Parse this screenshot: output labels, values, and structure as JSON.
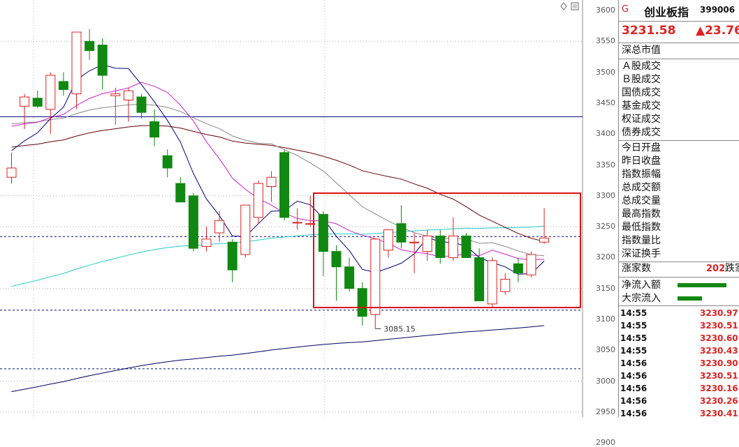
{
  "chart": {
    "y_ticks": [
      "3600",
      "3550",
      "3500",
      "3450",
      "3400",
      "3350",
      "3300",
      "3250",
      "3200",
      "3150",
      "3100",
      "3050",
      "3000",
      "2950",
      "2900"
    ],
    "low_label": "3085.15",
    "colors": {
      "up": "#dd2222",
      "down": "#118811",
      "ma5": "#000080",
      "ma10": "#cc22cc",
      "ma20": "#888888",
      "ma30": "#660000",
      "ma60": "#22cccc",
      "ma120": "#000060",
      "highlight_box": "#dd1111",
      "h_solid": "#000080",
      "h_dashed": "#000080"
    }
  },
  "chart_data": {
    "type": "candlestick",
    "ylim": [
      2900,
      3600
    ],
    "candles": [
      {
        "o": 3330,
        "h": 3370,
        "l": 3320,
        "c": 3345
      },
      {
        "o": 3445,
        "h": 3465,
        "l": 3408,
        "c": 3460
      },
      {
        "o": 3458,
        "h": 3470,
        "l": 3442,
        "c": 3445
      },
      {
        "o": 3440,
        "h": 3500,
        "l": 3400,
        "c": 3495
      },
      {
        "o": 3485,
        "h": 3500,
        "l": 3462,
        "c": 3472
      },
      {
        "o": 3465,
        "h": 3565,
        "l": 3440,
        "c": 3565
      },
      {
        "o": 3550,
        "h": 3570,
        "l": 3520,
        "c": 3535
      },
      {
        "o": 3544,
        "h": 3555,
        "l": 3472,
        "c": 3495
      },
      {
        "o": 3462,
        "h": 3475,
        "l": 3415,
        "c": 3465
      },
      {
        "o": 3455,
        "h": 3475,
        "l": 3420,
        "c": 3470
      },
      {
        "o": 3460,
        "h": 3465,
        "l": 3425,
        "c": 3435
      },
      {
        "o": 3420,
        "h": 3440,
        "l": 3380,
        "c": 3395
      },
      {
        "o": 3365,
        "h": 3375,
        "l": 3330,
        "c": 3345
      },
      {
        "o": 3320,
        "h": 3330,
        "l": 3290,
        "c": 3290
      },
      {
        "o": 3300,
        "h": 3305,
        "l": 3210,
        "c": 3215
      },
      {
        "o": 3218,
        "h": 3250,
        "l": 3210,
        "c": 3230
      },
      {
        "o": 3240,
        "h": 3275,
        "l": 3225,
        "c": 3260
      },
      {
        "o": 3225,
        "h": 3230,
        "l": 3160,
        "c": 3180
      },
      {
        "o": 3205,
        "h": 3285,
        "l": 3200,
        "c": 3285
      },
      {
        "o": 3265,
        "h": 3325,
        "l": 3255,
        "c": 3320
      },
      {
        "o": 3315,
        "h": 3340,
        "l": 3290,
        "c": 3330
      },
      {
        "o": 3370,
        "h": 3375,
        "l": 3260,
        "c": 3265
      },
      {
        "o": 3257,
        "h": 3280,
        "l": 3245,
        "c": 3257
      },
      {
        "o": 3255,
        "h": 3300,
        "l": 3250,
        "c": 3255
      },
      {
        "o": 3270,
        "h": 3275,
        "l": 3170,
        "c": 3210
      },
      {
        "o": 3210,
        "h": 3220,
        "l": 3130,
        "c": 3185
      },
      {
        "o": 3185,
        "h": 3200,
        "l": 3145,
        "c": 3150
      },
      {
        "o": 3150,
        "h": 3160,
        "l": 3090,
        "c": 3105
      },
      {
        "o": 3108,
        "h": 3230,
        "l": 3085,
        "c": 3230
      },
      {
        "o": 3212,
        "h": 3245,
        "l": 3200,
        "c": 3245
      },
      {
        "o": 3255,
        "h": 3285,
        "l": 3215,
        "c": 3225
      },
      {
        "o": 3225,
        "h": 3240,
        "l": 3175,
        "c": 3225
      },
      {
        "o": 3210,
        "h": 3245,
        "l": 3195,
        "c": 3235
      },
      {
        "o": 3235,
        "h": 3245,
        "l": 3190,
        "c": 3200
      },
      {
        "o": 3200,
        "h": 3265,
        "l": 3195,
        "c": 3235
      },
      {
        "o": 3235,
        "h": 3240,
        "l": 3205,
        "c": 3200
      },
      {
        "o": 3200,
        "h": 3215,
        "l": 3130,
        "c": 3130
      },
      {
        "o": 3125,
        "h": 3200,
        "l": 3120,
        "c": 3195
      },
      {
        "o": 3145,
        "h": 3175,
        "l": 3140,
        "c": 3165
      },
      {
        "o": 3190,
        "h": 3200,
        "l": 3160,
        "c": 3175
      },
      {
        "o": 3172,
        "h": 3210,
        "l": 3168,
        "c": 3205
      },
      {
        "o": 3225,
        "h": 3280,
        "l": 3222,
        "c": 3231.58
      }
    ]
  },
  "panel": {
    "g_mark": "G",
    "name": "创业板指",
    "code": "399006",
    "price": "3231.58",
    "change": "▲23.76",
    "group1": [
      "深总市值"
    ],
    "group2": [
      "Ａ股成交",
      "Ｂ股成交",
      "国债成交",
      "基金成交",
      "权证成交",
      "债券成交"
    ],
    "group3": [
      "今日开盘",
      "昨日收盘",
      "指数振幅",
      "总成交额",
      "总成交量",
      "最高指数",
      "最低指数",
      "指数量比",
      "深证换手"
    ],
    "rise_label": "涨家数",
    "rise_value": "202",
    "fall_label": "跌家",
    "flow": [
      {
        "label": "净流入额",
        "bar_ratio": 0.7
      },
      {
        "label": "大宗流入",
        "bar_ratio": 0.35
      }
    ],
    "trades": [
      {
        "time": "14:55",
        "price": "3230.97"
      },
      {
        "time": "14:55",
        "price": "3230.51"
      },
      {
        "time": "14:55",
        "price": "3230.60"
      },
      {
        "time": "14:55",
        "price": "3230.43"
      },
      {
        "time": "14:56",
        "price": "3230.90"
      },
      {
        "time": "14:56",
        "price": "3230.51"
      },
      {
        "time": "14:56",
        "price": "3230.16"
      },
      {
        "time": "14:56",
        "price": "3230.26"
      },
      {
        "time": "14:56",
        "price": "3230.41"
      }
    ]
  }
}
